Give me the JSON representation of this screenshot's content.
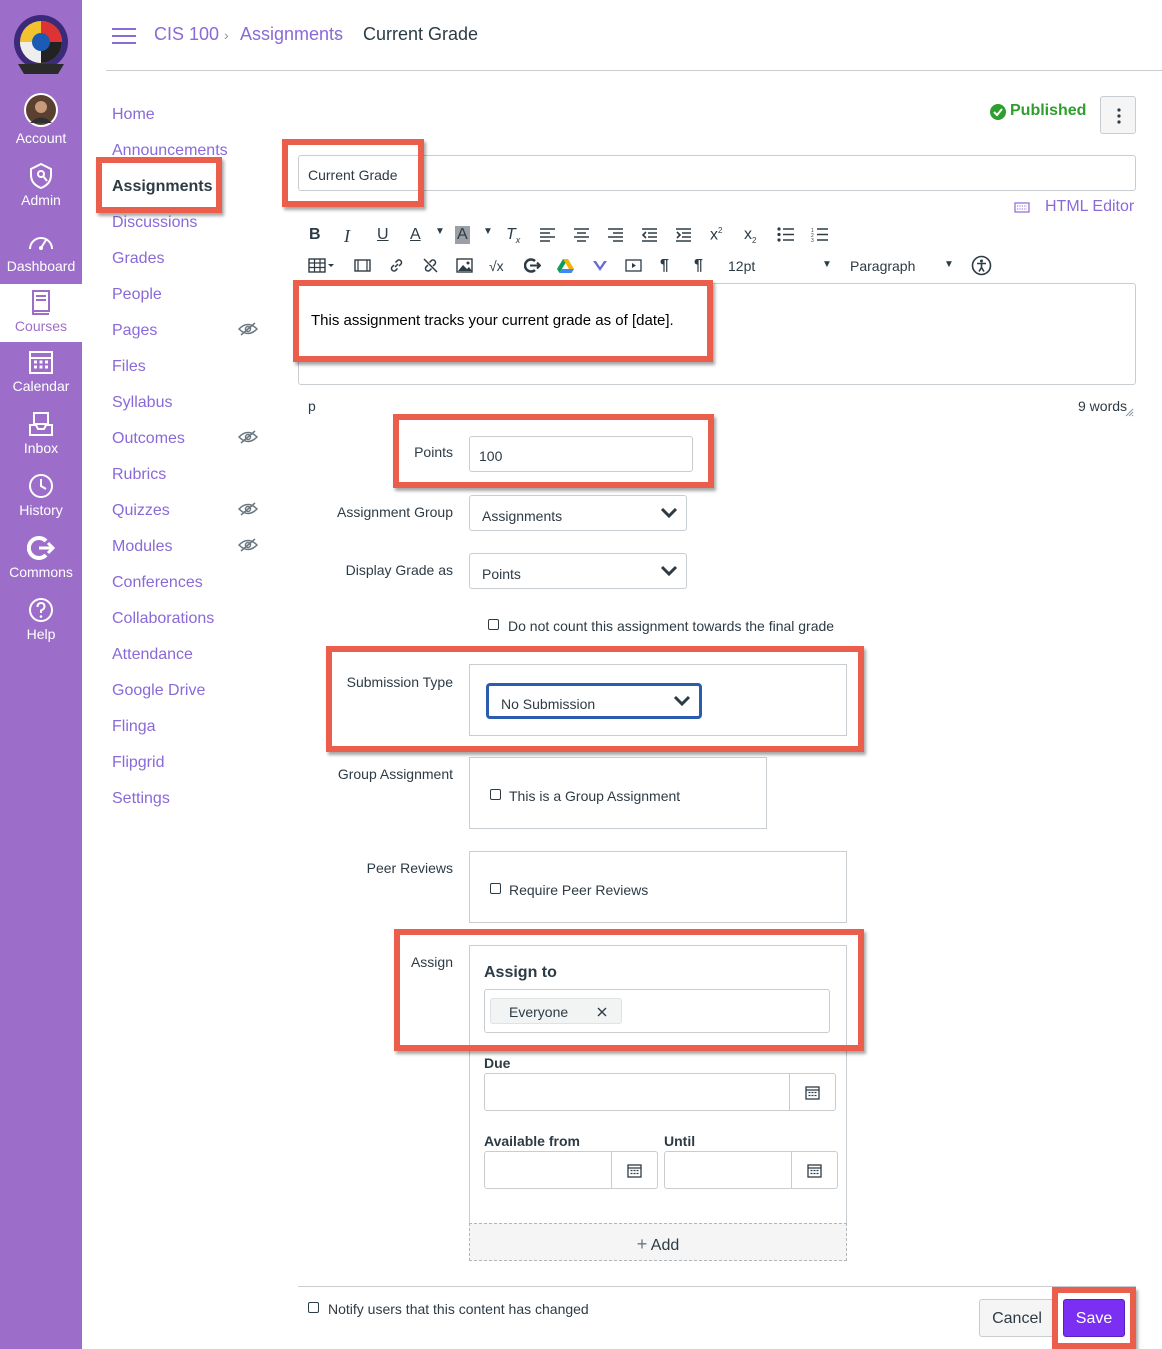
{
  "global_nav": {
    "items": [
      {
        "label": "Account",
        "icon": "avatar"
      },
      {
        "label": "Admin",
        "icon": "shield-icon"
      },
      {
        "label": "Dashboard",
        "icon": "dashboard-icon"
      },
      {
        "label": "Courses",
        "icon": "courses-icon"
      },
      {
        "label": "Calendar",
        "icon": "calendar-icon"
      },
      {
        "label": "Inbox",
        "icon": "inbox-icon"
      },
      {
        "label": "History",
        "icon": "history-icon"
      },
      {
        "label": "Commons",
        "icon": "commons-icon"
      },
      {
        "label": "Help",
        "icon": "help-icon"
      }
    ],
    "active": "Courses",
    "bg_color": "#9d6ec9"
  },
  "breadcrumb": {
    "course": "CIS 100",
    "section": "Assignments",
    "current": "Current Grade",
    "separator": "›"
  },
  "course_nav": {
    "items": [
      "Home",
      "Announcements",
      "Assignments",
      "Discussions",
      "Grades",
      "People",
      "Pages",
      "Files",
      "Syllabus",
      "Outcomes",
      "Rubrics",
      "Quizzes",
      "Modules",
      "Conferences",
      "Collaborations",
      "Attendance",
      "Google Drive",
      "Flinga",
      "Flipgrid",
      "Settings"
    ],
    "active": "Assignments",
    "link_color": "#8a69d8"
  },
  "header": {
    "status": "Published",
    "status_color": "#2e9f2e"
  },
  "editor": {
    "title_value": "Current Grade",
    "html_editor_label": "HTML Editor",
    "font_size": "12pt",
    "block_format": "Paragraph",
    "body_text": "This assignment tracks your current grade as of [date].",
    "path": "p",
    "word_count": "9 words"
  },
  "form": {
    "points_label": "Points",
    "points_value": "100",
    "group_label": "Assignment Group",
    "group_value": "Assignments",
    "display_label": "Display Grade as",
    "display_value": "Points",
    "no_count_label": "Do not count this assignment towards the final grade",
    "submission_label": "Submission Type",
    "submission_value": "No Submission",
    "group_assign_label": "Group Assignment",
    "group_assign_option": "This is a Group Assignment",
    "peer_label": "Peer Reviews",
    "peer_option": "Require Peer Reviews",
    "assign_label": "Assign",
    "assign_to_heading": "Assign to",
    "assignee_tag": "Everyone",
    "due_label": "Due",
    "available_from_label": "Available from",
    "until_label": "Until",
    "add_label": "Add"
  },
  "footer": {
    "notify_label": "Notify users that this content has changed",
    "cancel_label": "Cancel",
    "save_label": "Save",
    "save_color": "#7b2ff2"
  },
  "highlight_color": "#eb5e4c"
}
